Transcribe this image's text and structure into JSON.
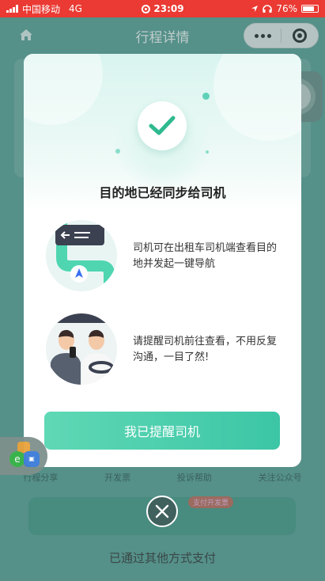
{
  "status_bar": {
    "carrier": "中国移动",
    "network": "4G",
    "time": "23:09",
    "battery": "76%",
    "battery_level": 0.76
  },
  "page": {
    "title": "行程详情",
    "actions": [
      "行程分享",
      "开发票",
      "投诉帮助",
      "关注公众号"
    ],
    "badge": "支付开发票",
    "paid_text": "已通过其他方式支付"
  },
  "modal": {
    "title": "目的地已经同步给司机",
    "features": [
      {
        "text": "司机可在出租车司机端查看目的地并发起一键导航",
        "icon": "navigation-illustration"
      },
      {
        "text": "请提醒司机前往查看，不用反复沟通，一目了然!",
        "icon": "driver-passenger-illustration"
      }
    ],
    "cta_label": "我已提醒司机",
    "accent": "#3cc6a6"
  },
  "icons": {
    "home": "home-icon",
    "more": "more-icon",
    "close_miniprogram": "target-icon",
    "check": "check-icon",
    "dismiss": "close-icon"
  }
}
